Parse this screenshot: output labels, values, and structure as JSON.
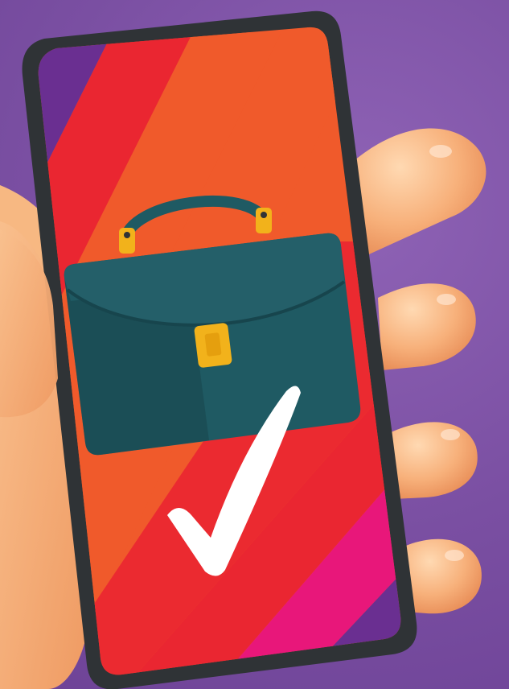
{
  "scene": {
    "description_label": "",
    "colors": {
      "background": "#7b4fa3",
      "phone_frame": "#2f3336",
      "stripe_purple": "#6a2f91",
      "stripe_red": "#ea2631",
      "stripe_orange": "#f05a2b",
      "stripe_magenta": "#e8177a",
      "briefcase": "#1f5a63",
      "briefcase_dark": "#17454d",
      "clasp": "#f2b21b",
      "checkmark": "#ffffff",
      "skin": "#f6b27a"
    },
    "icons": {
      "main_icon": "briefcase-icon",
      "status_icon": "checkmark-icon"
    }
  }
}
